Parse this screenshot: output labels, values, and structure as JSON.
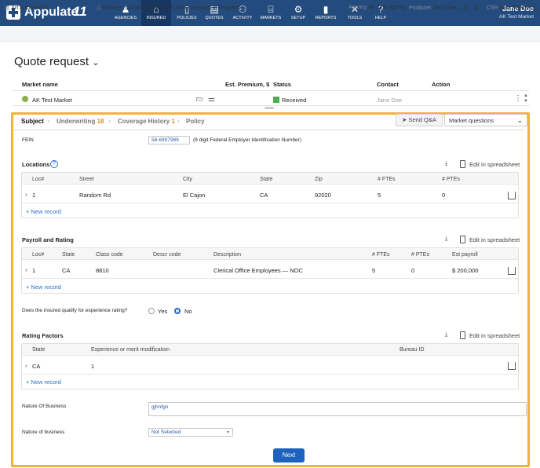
{
  "topbar": {
    "brand": "Appulate",
    "brand_mark": "11",
    "nav": [
      {
        "label": "AGENCIES",
        "icon": "agencies-icon"
      },
      {
        "label": "INSURED",
        "icon": "insured-icon"
      },
      {
        "label": "POLICIES",
        "icon": "policies-icon"
      },
      {
        "label": "QUOTES",
        "icon": "quotes-icon"
      },
      {
        "label": "ACTIVITY",
        "icon": "activity-icon"
      },
      {
        "label": "MARKETS",
        "icon": "markets-icon"
      },
      {
        "label": "SETUP",
        "icon": "setup-icon"
      },
      {
        "label": "REPORTS",
        "icon": "reports-icon"
      },
      {
        "label": "TOOLS",
        "icon": "tools-icon"
      },
      {
        "label": "HELP",
        "icon": "help-icon"
      }
    ],
    "user_name": "Jane Doe",
    "user_org": "AK Test Market"
  },
  "subbar": {
    "insured": "Art & Ceramics",
    "lob": "Workers' Compensation",
    "date": "08/21/2022",
    "status": "Request in Progress",
    "agency_label": "Agency",
    "agency": "AK Test Agency",
    "producer_label": "Producer",
    "producer": "Jane Doe",
    "csr_label": "CSR",
    "csr": "[Not Selected]"
  },
  "page_title": "Quote request",
  "markets_table": {
    "headers": [
      "Market name",
      "Est. Premium, $",
      "Status",
      "Contact",
      "Action"
    ],
    "row": {
      "name": "AK Test Market",
      "status": "Received",
      "contact": "Jane Doe"
    }
  },
  "tabs": [
    {
      "label": "Subject",
      "count": ""
    },
    {
      "label": "Underwriting",
      "count": "18"
    },
    {
      "label": "Coverage History",
      "count": "1"
    },
    {
      "label": "Policy",
      "count": ""
    }
  ],
  "send_qa": "Send Q&A",
  "market_questions": "Market questions",
  "fein": {
    "label": "FEIN",
    "value": "58-6997989",
    "hint": "(9 digit Federal Employer Identification Number)"
  },
  "edit_in_spreadsheet": "Edit in spreadsheet",
  "new_record": "New record",
  "locations": {
    "title": "Locations",
    "headers": [
      "Loc#",
      "Street",
      "City",
      "State",
      "Zip",
      "# FTEs",
      "# PTEs"
    ],
    "rows": [
      [
        "1",
        "Random Rd",
        "El Cajon",
        "CA",
        "92020",
        "5",
        "0"
      ]
    ]
  },
  "payroll": {
    "title": "Payroll and Rating",
    "headers": [
      "Loc#",
      "State",
      "Class code",
      "Descr code",
      "Description",
      "# FTEs",
      "# PTEs",
      "Est payroll"
    ],
    "rows": [
      [
        "1",
        "CA",
        "8810",
        "",
        "Clerical Office Employees — NOC",
        "5",
        "0",
        "$ 200,000"
      ]
    ]
  },
  "experience": {
    "question": "Does the insured qualify for experience rating?",
    "yes": "Yes",
    "no": "No",
    "selected": "No"
  },
  "rating": {
    "title": "Rating Factors",
    "headers": [
      "State",
      "Experience or merit modification",
      "Bureau ID"
    ],
    "rows": [
      [
        "CA",
        "1",
        ""
      ]
    ]
  },
  "nature1": {
    "label": "Nature Of Business",
    "value": "gjhnfgn"
  },
  "nature2": {
    "label": "Nature of business",
    "value": "Not Selected"
  },
  "next": "Next",
  "colors": {
    "topbar": "#234b7e",
    "accent": "#f0b33c",
    "link": "#2a6fcb",
    "button": "#1e62bf",
    "received": "#4caf50"
  }
}
